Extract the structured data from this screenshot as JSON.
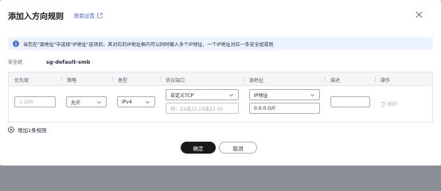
{
  "dialog": {
    "title": "添加入方向规则",
    "help_link": "教我设置"
  },
  "notice": {
    "text": "当您在\"源地址\"中选择\"IP地址\"选项后，其对应的IP地址框内可以同时输入多个IP地址，一个IP地址对应一条安全组规则"
  },
  "security_group": {
    "label": "安全组",
    "value": "sg-default-smb"
  },
  "table": {
    "headers": [
      "优先级",
      "策略",
      "类型",
      "协议端口",
      "源地址",
      "描述",
      "操作"
    ],
    "row": {
      "priority_placeholder": "1-100",
      "policy": "允许",
      "type": "IPv4",
      "protocol": "自定义TCP",
      "port_placeholder": "例：22或22,24或22-30",
      "source_type": "IP地址",
      "source_value": "0.0.0.0/0",
      "description": "",
      "delete_label": "删除"
    }
  },
  "add_rule": {
    "label": "增加1条规则"
  },
  "buttons": {
    "ok": "确定",
    "cancel": "取消"
  },
  "colors": {
    "link": "#526ecc",
    "info": "#526ecc",
    "primary_button": "#191919"
  }
}
